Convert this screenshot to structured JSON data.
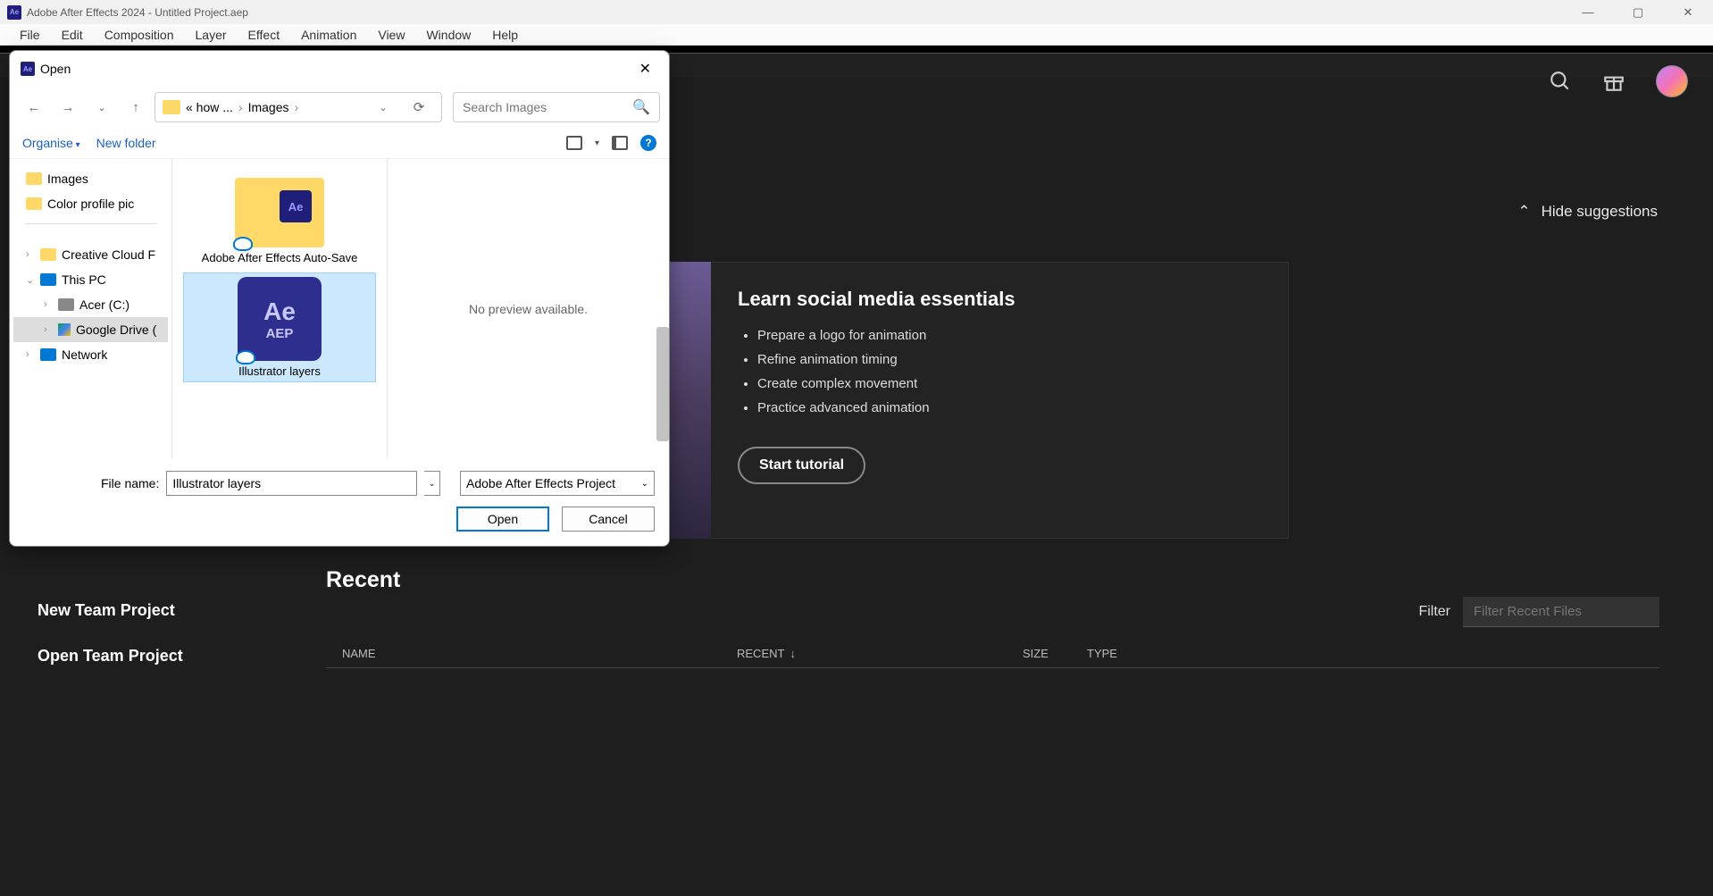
{
  "titleBar": {
    "appTitle": "Adobe After Effects 2024 - Untitled Project.aep"
  },
  "menu": {
    "items": [
      "File",
      "Edit",
      "Composition",
      "Layer",
      "Effect",
      "Animation",
      "View",
      "Window",
      "Help"
    ]
  },
  "home": {
    "hideSuggestions": "Hide suggestions",
    "learn": {
      "title": "Learn social media essentials",
      "bullets": [
        "Prepare a logo for animation",
        "Refine animation timing",
        "Create complex movement",
        "Practice advanced animation"
      ],
      "cta": "Start tutorial"
    },
    "sideLinks": [
      "New Team Project",
      "Open Team Project"
    ],
    "recent": {
      "heading": "Recent",
      "filterLabel": "Filter",
      "filterPlaceholder": "Filter Recent Files",
      "columns": {
        "name": "NAME",
        "recent": "RECENT",
        "size": "SIZE",
        "type": "TYPE"
      }
    }
  },
  "dialog": {
    "title": "Open",
    "breadcrumb": {
      "truncLabel": "« how ...",
      "leaf": "Images"
    },
    "searchPlaceholder": "Search Images",
    "toolbar": {
      "organise": "Organise",
      "newFolder": "New folder"
    },
    "tree": {
      "images": "Images",
      "colorProfile": "Color profile pic",
      "ccf": "Creative Cloud F",
      "thisPC": "This PC",
      "acer": "Acer (C:)",
      "gdrive": "Google Drive (",
      "network": "Network"
    },
    "files": {
      "folder1": "Adobe After Effects Auto-Save",
      "file1": "Illustrator layers"
    },
    "preview": "No preview available.",
    "fileNameLabel": "File name:",
    "fileNameValue": "Illustrator layers",
    "typeFilter": "Adobe After Effects Project",
    "openBtn": "Open",
    "cancelBtn": "Cancel"
  }
}
